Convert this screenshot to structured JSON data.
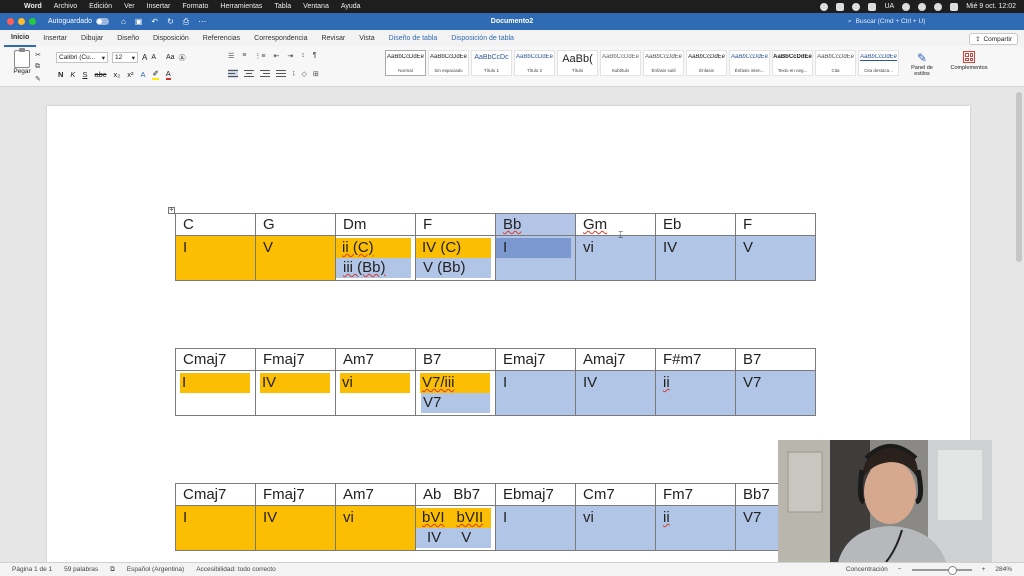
{
  "menubar": {
    "app": "Word",
    "items": [
      "Archivo",
      "Edición",
      "Ver",
      "Insertar",
      "Formato",
      "Herramientas",
      "Tabla",
      "Ventana",
      "Ayuda"
    ],
    "locale": "UA",
    "datetime": "Mié 9 oct.  12:02"
  },
  "titlebar": {
    "autosave_label": "Autoguardado",
    "title": "Documento2",
    "search_placeholder": "Buscar (Cmd + Ctrl + U)"
  },
  "ribbon_tabs": [
    "Inicio",
    "Insertar",
    "Dibujar",
    "Diseño",
    "Disposición",
    "Referencias",
    "Correspondencia",
    "Revisar",
    "Vista",
    "Diseño de tabla",
    "Disposición de tabla"
  ],
  "share_label": "Compartir",
  "ribbon": {
    "paste_label": "Pegar",
    "font_name": "Calibri (Cu...",
    "font_size": "12",
    "styles": [
      {
        "sample": "AaBbCcDdEe",
        "name": "Normal"
      },
      {
        "sample": "AaBbCcDdEe",
        "name": "Sin espaciado"
      },
      {
        "sample": "AaBbCcDc",
        "name": "Título 1"
      },
      {
        "sample": "AaBbCcDdEe",
        "name": "Título 2"
      },
      {
        "sample": "AaBb(",
        "name": "Título"
      },
      {
        "sample": "AaBbCcDdEe",
        "name": "Subtítulo"
      },
      {
        "sample": "AaBbCcDdEe",
        "name": "Énfasis sutil"
      },
      {
        "sample": "AaBbCcDdEe",
        "name": "Énfasis"
      },
      {
        "sample": "AaBbCcDdEe",
        "name": "Énfasis inten..."
      },
      {
        "sample": "AaBbCcDdEe",
        "name": "Texto en neg..."
      },
      {
        "sample": "AaBbCcDdEe",
        "name": "Cita"
      },
      {
        "sample": "AaBbCcDdEe",
        "name": "Cita destaca..."
      }
    ],
    "styles_panel_label": "Panel de estilos",
    "addins_label": "Complementos"
  },
  "document": {
    "table1": {
      "headers": [
        "C",
        "G",
        "Dm",
        "F",
        "Bb",
        "Gm",
        "Eb",
        "F"
      ],
      "degrees": [
        [
          "I"
        ],
        [
          "V"
        ],
        [
          "ii (C)",
          "iii (Bb)"
        ],
        [
          "IV (C)",
          "V (Bb)"
        ],
        [
          "I"
        ],
        [
          "vi"
        ],
        [
          "IV"
        ],
        [
          "V"
        ]
      ]
    },
    "table2": {
      "headers": [
        "Cmaj7",
        "Fmaj7",
        "Am7",
        "B7",
        "Emaj7",
        "Amaj7",
        "F#m7",
        "B7"
      ],
      "degrees": [
        [
          "I"
        ],
        [
          "IV"
        ],
        [
          "vi"
        ],
        [
          "V7/iii",
          "V7"
        ],
        [
          "I"
        ],
        [
          "IV"
        ],
        [
          "ii"
        ],
        [
          "V7"
        ]
      ]
    },
    "table3": {
      "headers": [
        "Cmaj7",
        "Fmaj7",
        "Am7",
        "Ab",
        "Bb7",
        "Ebmaj7",
        "Cm7",
        "Fm7",
        "Bb7"
      ],
      "degrees": [
        [
          "I"
        ],
        [
          "IV"
        ],
        [
          "vi"
        ],
        [
          "bVI",
          "bVII",
          "IV",
          "V"
        ],
        [
          "I"
        ],
        [
          "vi"
        ],
        [
          "ii"
        ],
        [
          "V7"
        ]
      ]
    }
  },
  "colors": {
    "orange": "#fbbe03",
    "blue": "#b1c5e6",
    "header_blue": "#b3c6e7",
    "selection_blue": "#7b98cf",
    "word_blue": "#2f6ab4"
  },
  "statusbar": {
    "page": "Página 1 de 1",
    "words": "59 palabras",
    "language": "Español (Argentina)",
    "accessibility": "Accesibilidad: todo correcto",
    "focus": "Concentración",
    "zoom": "284%"
  }
}
